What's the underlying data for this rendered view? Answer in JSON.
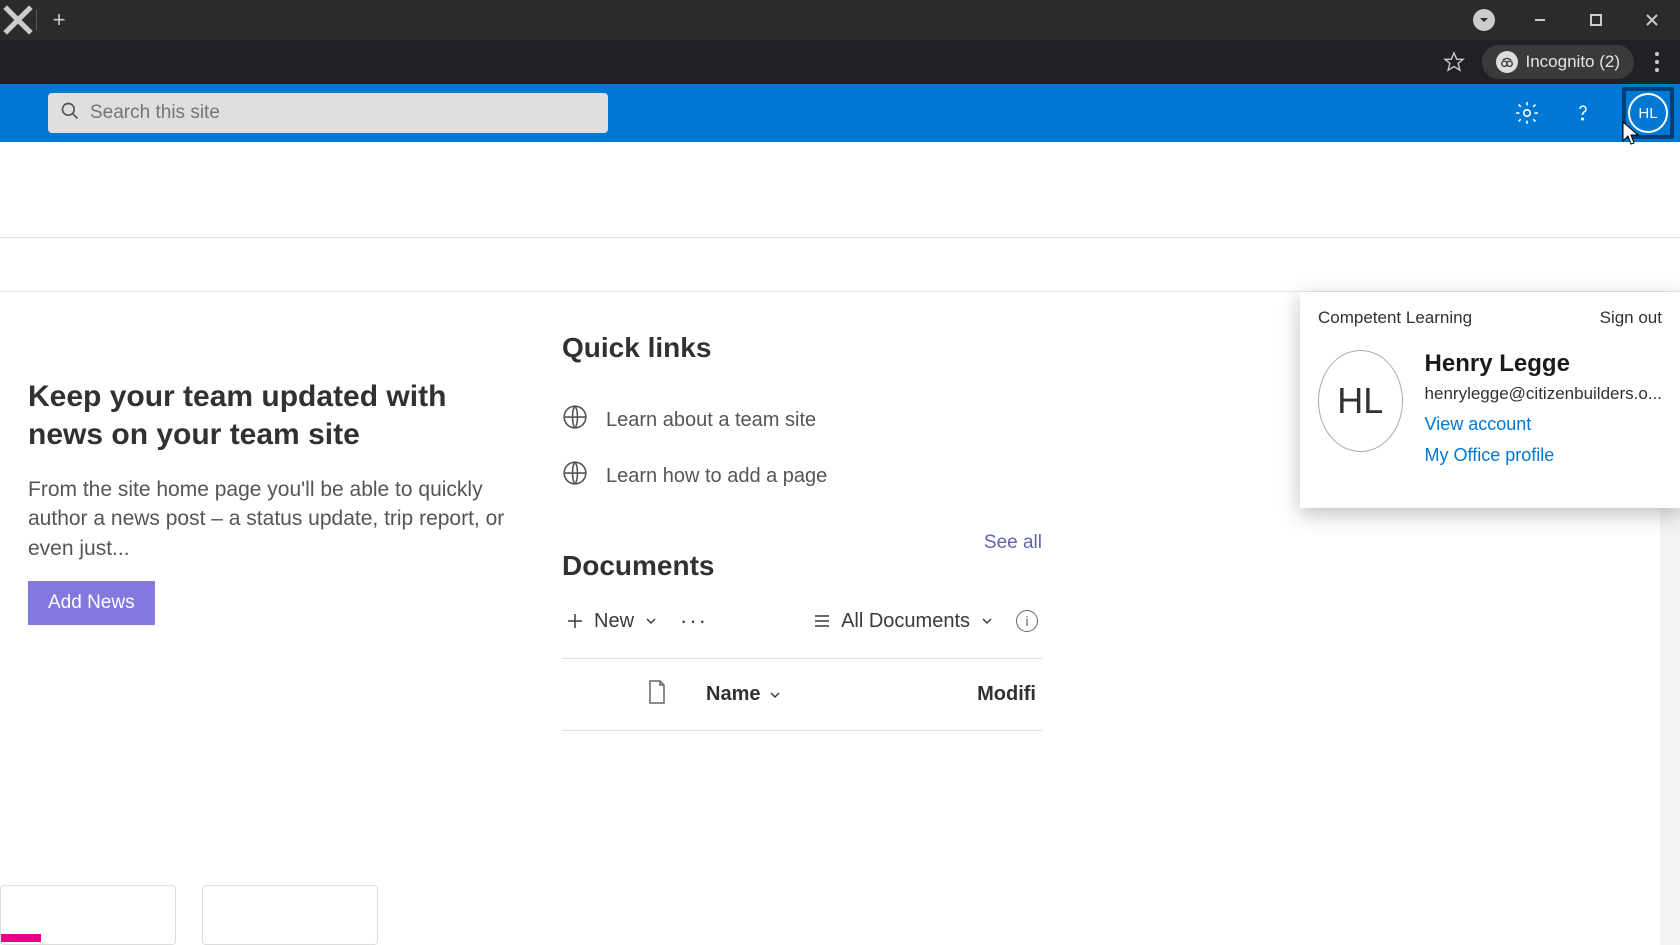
{
  "browser": {
    "incognito_label": "Incognito (2)"
  },
  "header": {
    "search_placeholder": "Search this site",
    "avatar_initials": "HL"
  },
  "account_panel": {
    "tenant": "Competent Learning",
    "sign_out": "Sign out",
    "avatar_initials": "HL",
    "name": "Henry Legge",
    "email": "henrylegge@citizenbuilders.o...",
    "view_account": "View account",
    "office_profile": "My Office profile"
  },
  "news": {
    "title": "Keep your team updated with news on your team site",
    "body": "From the site home page you'll be able to quickly author a news post – a status update, trip report, or even just...",
    "button": "Add News"
  },
  "quick_links": {
    "title": "Quick links",
    "items": [
      {
        "label": "Learn about a team site"
      },
      {
        "label": "Learn how to add a page"
      }
    ]
  },
  "documents": {
    "title": "Documents",
    "see_all": "See all",
    "toolbar": {
      "new": "New",
      "all_docs": "All Documents"
    },
    "columns": {
      "name": "Name",
      "modified": "Modifi"
    }
  }
}
